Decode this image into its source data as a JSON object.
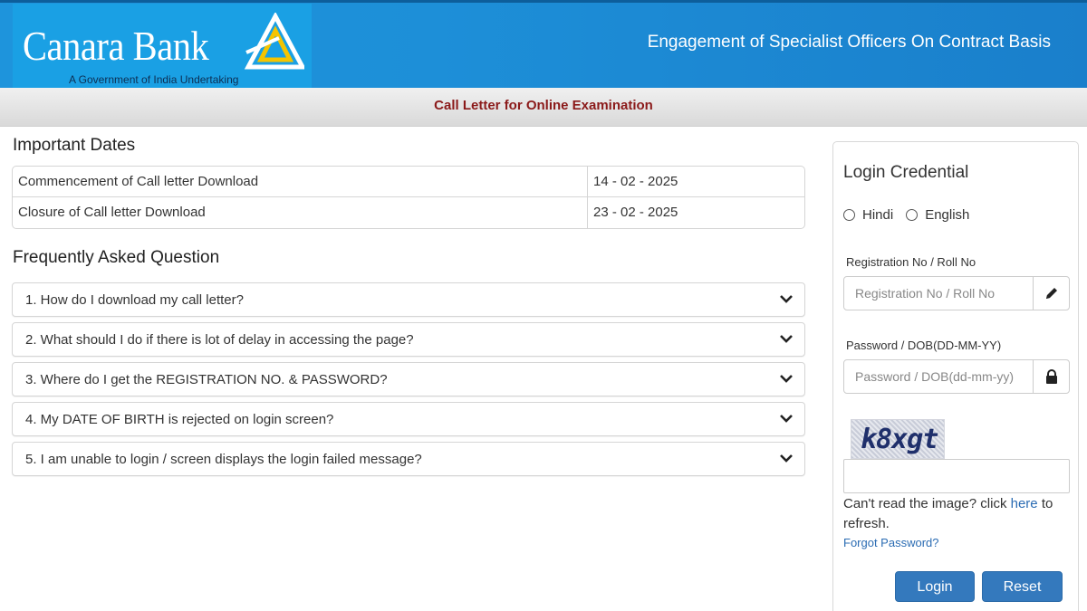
{
  "header": {
    "brand_name": "Canara Bank",
    "brand_tagline": "A Government of India Undertaking",
    "title": "Engagement of Specialist Officers On Contract Basis"
  },
  "subbar": {
    "title": "Call Letter for Online Examination"
  },
  "important_dates": {
    "heading": "Important Dates",
    "rows": [
      {
        "label": "Commencement of Call letter Download",
        "value": "14 - 02 - 2025"
      },
      {
        "label": "Closure of Call letter Download",
        "value": "23 - 02 - 2025"
      }
    ]
  },
  "faq": {
    "heading": "Frequently Asked Question",
    "items": [
      "1. How do I download my call letter?",
      "2. What should I do if there is lot of delay in accessing the page?",
      "3. Where do I get the REGISTRATION NO. & PASSWORD?",
      "4. My DATE OF BIRTH is rejected on login screen?",
      "5. I am unable to login / screen displays the login failed message?"
    ]
  },
  "login": {
    "title": "Login Credential",
    "languages": [
      "Hindi",
      "English"
    ],
    "registration_label": "Registration No / Roll No",
    "registration_placeholder": "Registration No / Roll No",
    "password_label": "Password / DOB(DD-MM-YY)",
    "password_placeholder": "Password / DOB(dd-mm-yy)",
    "captcha_text": "k8xgt",
    "refresh_prefix": "Can't read the image? click ",
    "refresh_link": "here",
    "refresh_suffix": " to refresh.",
    "forgot_label": "Forgot Password?",
    "login_label": "Login",
    "reset_label": "Reset"
  },
  "colors": {
    "header_blue": "#1d8fd8",
    "logo_blue": "#1aa0e4",
    "subbar_title": "#8b1a1a",
    "button_blue": "#3479bd",
    "link_blue": "#2b6cb3"
  },
  "icons": {
    "logo_mark": "canara-triangle-logo",
    "faq_toggle": "chevron-down-icon",
    "registration_addon": "pencil-icon",
    "password_addon": "lock-icon"
  }
}
